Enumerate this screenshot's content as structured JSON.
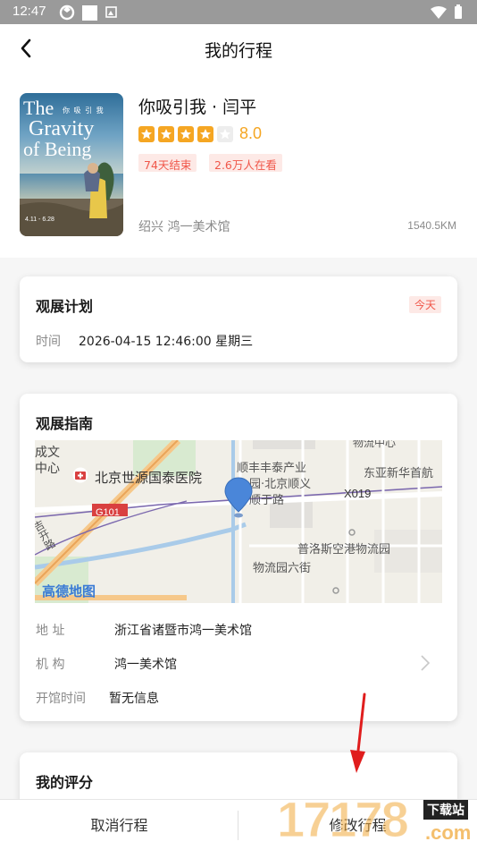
{
  "status_bar": {
    "time": "12:47"
  },
  "nav": {
    "title": "我的行程"
  },
  "exhibition": {
    "title": "你吸引我 · 闫平",
    "score": "8.0",
    "stars": 4,
    "tags": [
      "74天结束",
      "2.6万人在看"
    ],
    "city": "绍兴  鸿一美术馆",
    "distance": "1540.5KM",
    "poster": {
      "line1": "The",
      "line1b": "你 吸 引 我",
      "line2": "Gravity",
      "line3": "of Being",
      "dates": "4.11 - 6.28"
    }
  },
  "plan": {
    "title": "观展计划",
    "badge": "今天",
    "time_label": "时间",
    "time_value": "2026-04-15 12:46:00  星期三"
  },
  "guide": {
    "title": "观展指南",
    "address_label": "地    址",
    "address_value": "浙江省诸暨市鸿一美术馆",
    "org_label": "机    构",
    "org_value": "鸿一美术馆",
    "hours_label": "开馆时间",
    "hours_value": "暂无信息",
    "map": {
      "hospital": "北京世源国泰医院",
      "left_top1": "成文",
      "left_top2": "中心",
      "top_right": "物流中心",
      "shunfeng1": "顺丰丰泰产业",
      "shunfeng2": "园·北京顺义",
      "road1": "顺于路",
      "x019": "X019",
      "dongya": "东亚新华首航",
      "g101": "G101",
      "puluo": "普洛斯空港物流园",
      "wuliu": "物流园六街",
      "jiyun": "吉开路",
      "brand": "高德地图"
    }
  },
  "review": {
    "title": "我的评分"
  },
  "bottom": {
    "cancel": "取消行程",
    "modify": "修改行程"
  },
  "watermark": {
    "digits": "17178",
    "suffix": "下载站",
    "com": ".com"
  },
  "colors": {
    "accent_red": "#f0574a",
    "star_orange": "#f5a623",
    "route_purple": "#7b68ae",
    "river_blue": "#a9cbe9"
  }
}
